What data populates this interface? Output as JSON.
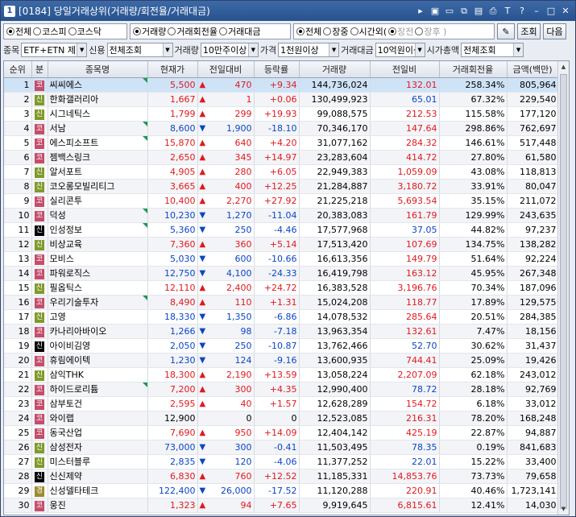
{
  "window": {
    "num": "1",
    "title": "[0184] 당일거래상위(거래량/회전율/거래대금)"
  },
  "titlebar_icons": [
    "arrow-right-icon",
    "m-icon",
    "window-icon",
    "link-icon",
    "tile-icon",
    "print-icon",
    "font-icon",
    "help-icon",
    "minimize-icon",
    "maximize-icon",
    "close-icon"
  ],
  "titlebar_glyphs": [
    "▸",
    "▣",
    "▭",
    "⧉",
    "▤",
    "⎙",
    "T",
    "?",
    "–",
    "□",
    "✕"
  ],
  "market_group": [
    {
      "label": "전체",
      "on": true
    },
    {
      "label": "코스피",
      "on": false
    },
    {
      "label": "코스닥",
      "on": false
    }
  ],
  "sort_group": [
    {
      "label": "거래량",
      "on": true
    },
    {
      "label": "거래회전율",
      "on": false
    },
    {
      "label": "거래대금",
      "on": false
    }
  ],
  "time_group": [
    {
      "label": "전체",
      "on": true,
      "dis": false
    },
    {
      "label": "장중",
      "on": false,
      "dis": false
    },
    {
      "label": "시간외(",
      "on": false,
      "dis": false
    },
    {
      "label": "장전",
      "on": true,
      "dis": true
    },
    {
      "label": "장후 )",
      "on": false,
      "dis": true
    }
  ],
  "buttons": {
    "settings_glyph": "✎",
    "query": "조회",
    "next": "다음"
  },
  "filters": {
    "stock_label": "종목",
    "stock_value": "ETF+ETN 제",
    "credit_label": "신용",
    "credit_value": "전체조회",
    "volume_label": "거래량",
    "volume_value": "10만주이상",
    "price_label": "가격",
    "price_value": "1천원이상",
    "amount_label": "거래대금",
    "amount_value": "10억원이상",
    "cap_label": "시가총액",
    "cap_value": "전체조회"
  },
  "columns": [
    "순위",
    "분",
    "종목명",
    "현재가",
    "전일대비",
    "등락률",
    "거래량",
    "전일비",
    "거래회전율",
    "금액(백만)"
  ],
  "colors": {
    "up": "#e0191e",
    "down": "#0a45c8"
  },
  "rows": [
    {
      "rank": "1",
      "mkt": "코",
      "badge": "g",
      "name": "씨씨에스",
      "flag": true,
      "price": "5,500",
      "dir": "up",
      "chg": "470",
      "rate": "+9.34",
      "vol": "144,736,024",
      "prev": "132.01",
      "prevdir": "up",
      "turn": "258.34%",
      "amt": "805,964"
    },
    {
      "rank": "2",
      "mkt": "신",
      "badge": "s",
      "name": "한화갤러리아",
      "flag": false,
      "price": "1,667",
      "dir": "up",
      "chg": "1",
      "rate": "+0.06",
      "vol": "130,499,923",
      "prev": "65.01",
      "prevdir": "dn",
      "turn": "67.32%",
      "amt": "229,540"
    },
    {
      "rank": "3",
      "mkt": "신",
      "badge": "s",
      "name": "시그네틱스",
      "flag": false,
      "price": "1,799",
      "dir": "up",
      "chg": "299",
      "rate": "+19.93",
      "vol": "99,088,575",
      "prev": "212.53",
      "prevdir": "up",
      "turn": "115.58%",
      "amt": "177,120"
    },
    {
      "rank": "4",
      "mkt": "코",
      "badge": "g",
      "name": "서남",
      "flag": true,
      "price": "8,600",
      "dir": "dn",
      "chg": "1,900",
      "rate": "-18.10",
      "vol": "70,346,170",
      "prev": "147.64",
      "prevdir": "up",
      "turn": "298.86%",
      "amt": "762,697"
    },
    {
      "rank": "5",
      "mkt": "코",
      "badge": "g",
      "name": "에스피소프트",
      "flag": true,
      "price": "15,870",
      "dir": "up",
      "chg": "640",
      "rate": "+4.20",
      "vol": "31,077,162",
      "prev": "284.32",
      "prevdir": "up",
      "turn": "146.61%",
      "amt": "517,448"
    },
    {
      "rank": "6",
      "mkt": "코",
      "badge": "g",
      "name": "젬백스링크",
      "flag": false,
      "price": "2,650",
      "dir": "up",
      "chg": "345",
      "rate": "+14.97",
      "vol": "23,283,604",
      "prev": "414.72",
      "prevdir": "up",
      "turn": "27.80%",
      "amt": "61,580"
    },
    {
      "rank": "7",
      "mkt": "신",
      "badge": "s",
      "name": "알서포트",
      "flag": false,
      "price": "4,905",
      "dir": "up",
      "chg": "280",
      "rate": "+6.05",
      "vol": "22,949,383",
      "prev": "1,059.09",
      "prevdir": "up",
      "turn": "43.08%",
      "amt": "118,813"
    },
    {
      "rank": "8",
      "mkt": "신",
      "badge": "s",
      "name": "코오롱모빌리티그",
      "flag": false,
      "price": "3,665",
      "dir": "up",
      "chg": "400",
      "rate": "+12.25",
      "vol": "21,284,887",
      "prev": "3,180.72",
      "prevdir": "up",
      "turn": "33.91%",
      "amt": "80,047"
    },
    {
      "rank": "9",
      "mkt": "코",
      "badge": "g",
      "name": "실리콘투",
      "flag": false,
      "price": "10,400",
      "dir": "up",
      "chg": "2,270",
      "rate": "+27.92",
      "vol": "21,225,218",
      "prev": "5,693.54",
      "prevdir": "up",
      "turn": "35.15%",
      "amt": "211,072"
    },
    {
      "rank": "10",
      "mkt": "코",
      "badge": "g",
      "name": "덕성",
      "flag": true,
      "price": "10,230",
      "dir": "dn",
      "chg": "1,270",
      "rate": "-11.04",
      "vol": "20,383,083",
      "prev": "161.79",
      "prevdir": "up",
      "turn": "129.99%",
      "amt": "243,635"
    },
    {
      "rank": "11",
      "mkt": "신",
      "badge": "k",
      "name": "인성정보",
      "flag": true,
      "price": "5,360",
      "dir": "dn",
      "chg": "250",
      "rate": "-4.46",
      "vol": "17,577,968",
      "prev": "37.05",
      "prevdir": "dn",
      "turn": "44.82%",
      "amt": "97,237"
    },
    {
      "rank": "12",
      "mkt": "신",
      "badge": "s",
      "name": "비상교육",
      "flag": false,
      "price": "7,360",
      "dir": "up",
      "chg": "360",
      "rate": "+5.14",
      "vol": "17,513,420",
      "prev": "107.69",
      "prevdir": "up",
      "turn": "134.75%",
      "amt": "138,282"
    },
    {
      "rank": "13",
      "mkt": "코",
      "badge": "g",
      "name": "모비스",
      "flag": false,
      "price": "5,030",
      "dir": "dn",
      "chg": "600",
      "rate": "-10.66",
      "vol": "16,613,356",
      "prev": "149.79",
      "prevdir": "up",
      "turn": "51.64%",
      "amt": "92,224"
    },
    {
      "rank": "14",
      "mkt": "코",
      "badge": "g",
      "name": "파워로직스",
      "flag": false,
      "price": "12,750",
      "dir": "dn",
      "chg": "4,100",
      "rate": "-24.33",
      "vol": "16,419,798",
      "prev": "163.12",
      "prevdir": "up",
      "turn": "45.95%",
      "amt": "267,348"
    },
    {
      "rank": "15",
      "mkt": "신",
      "badge": "s",
      "name": "필옵틱스",
      "flag": false,
      "price": "12,110",
      "dir": "up",
      "chg": "2,400",
      "rate": "+24.72",
      "vol": "16,383,528",
      "prev": "3,196.76",
      "prevdir": "up",
      "turn": "70.34%",
      "amt": "187,096"
    },
    {
      "rank": "16",
      "mkt": "코",
      "badge": "g",
      "name": "우리기술투자",
      "flag": true,
      "price": "8,490",
      "dir": "up",
      "chg": "110",
      "rate": "+1.31",
      "vol": "15,024,208",
      "prev": "118.77",
      "prevdir": "up",
      "turn": "17.89%",
      "amt": "129,575"
    },
    {
      "rank": "17",
      "mkt": "신",
      "badge": "s",
      "name": "고영",
      "flag": false,
      "price": "18,330",
      "dir": "dn",
      "chg": "1,350",
      "rate": "-6.86",
      "vol": "14,078,532",
      "prev": "285.64",
      "prevdir": "up",
      "turn": "20.51%",
      "amt": "284,385"
    },
    {
      "rank": "18",
      "mkt": "코",
      "badge": "g",
      "name": "카나리아바이오",
      "flag": false,
      "price": "1,266",
      "dir": "dn",
      "chg": "98",
      "rate": "-7.18",
      "vol": "13,963,354",
      "prev": "132.61",
      "prevdir": "up",
      "turn": "7.47%",
      "amt": "18,156"
    },
    {
      "rank": "19",
      "mkt": "신",
      "badge": "k",
      "name": "아이비김영",
      "flag": false,
      "price": "2,050",
      "dir": "dn",
      "chg": "250",
      "rate": "-10.87",
      "vol": "13,762,466",
      "prev": "52.70",
      "prevdir": "dn",
      "turn": "30.62%",
      "amt": "31,437"
    },
    {
      "rank": "20",
      "mkt": "코",
      "badge": "g",
      "name": "휴림에이텍",
      "flag": false,
      "price": "1,230",
      "dir": "dn",
      "chg": "124",
      "rate": "-9.16",
      "vol": "13,600,935",
      "prev": "744.41",
      "prevdir": "up",
      "turn": "25.09%",
      "amt": "19,426"
    },
    {
      "rank": "21",
      "mkt": "신",
      "badge": "s",
      "name": "삼익THK",
      "flag": false,
      "price": "18,300",
      "dir": "up",
      "chg": "2,190",
      "rate": "+13.59",
      "vol": "13,058,224",
      "prev": "2,207.09",
      "prevdir": "up",
      "turn": "62.18%",
      "amt": "243,012"
    },
    {
      "rank": "22",
      "mkt": "코",
      "badge": "g",
      "name": "하이드로리튬",
      "flag": true,
      "price": "7,200",
      "dir": "up",
      "chg": "300",
      "rate": "+4.35",
      "vol": "12,990,400",
      "prev": "78.72",
      "prevdir": "dn",
      "turn": "28.18%",
      "amt": "92,769"
    },
    {
      "rank": "23",
      "mkt": "코",
      "badge": "g",
      "name": "삼부토건",
      "flag": false,
      "price": "2,595",
      "dir": "up",
      "chg": "40",
      "rate": "+1.57",
      "vol": "12,628,289",
      "prev": "154.72",
      "prevdir": "up",
      "turn": "6.18%",
      "amt": "33,012"
    },
    {
      "rank": "24",
      "mkt": "코",
      "badge": "g",
      "name": "와이랩",
      "flag": false,
      "price": "12,900",
      "dir": "flat",
      "chg": "0",
      "rate": "0",
      "vol": "12,523,085",
      "prev": "216.31",
      "prevdir": "up",
      "turn": "78.20%",
      "amt": "168,248"
    },
    {
      "rank": "25",
      "mkt": "코",
      "badge": "g",
      "name": "동국산업",
      "flag": false,
      "price": "7,690",
      "dir": "up",
      "chg": "950",
      "rate": "+14.09",
      "vol": "12,404,142",
      "prev": "425.19",
      "prevdir": "up",
      "turn": "22.87%",
      "amt": "94,887"
    },
    {
      "rank": "26",
      "mkt": "신",
      "badge": "s",
      "name": "삼성전자",
      "flag": false,
      "price": "73,000",
      "dir": "dn",
      "chg": "300",
      "rate": "-0.41",
      "vol": "11,503,495",
      "prev": "78.35",
      "prevdir": "dn",
      "turn": "0.19%",
      "amt": "841,683"
    },
    {
      "rank": "27",
      "mkt": "신",
      "badge": "s",
      "name": "미스터블루",
      "flag": false,
      "price": "2,835",
      "dir": "dn",
      "chg": "120",
      "rate": "-4.06",
      "vol": "11,377,252",
      "prev": "22.01",
      "prevdir": "dn",
      "turn": "15.22%",
      "amt": "33,400"
    },
    {
      "rank": "28",
      "mkt": "신",
      "badge": "k",
      "name": "신신제약",
      "flag": false,
      "price": "6,830",
      "dir": "up",
      "chg": "760",
      "rate": "+12.52",
      "vol": "11,185,331",
      "prev": "14,853.76",
      "prevdir": "up",
      "turn": "73.73%",
      "amt": "79,658"
    },
    {
      "rank": "29",
      "mkt": "경",
      "badge": "ge",
      "name": "신성델타테크",
      "flag": false,
      "price": "122,400",
      "dir": "dn",
      "chg": "26,000",
      "rate": "-17.52",
      "vol": "11,120,288",
      "prev": "220.91",
      "prevdir": "up",
      "turn": "40.46%",
      "amt": "1,723,141"
    },
    {
      "rank": "30",
      "mkt": "코",
      "badge": "g",
      "name": "웅진",
      "flag": false,
      "price": "1,323",
      "dir": "up",
      "chg": "94",
      "rate": "+7.65",
      "vol": "9,919,645",
      "prev": "6,815.61",
      "prevdir": "up",
      "turn": "12.41%",
      "amt": "14,030"
    }
  ]
}
